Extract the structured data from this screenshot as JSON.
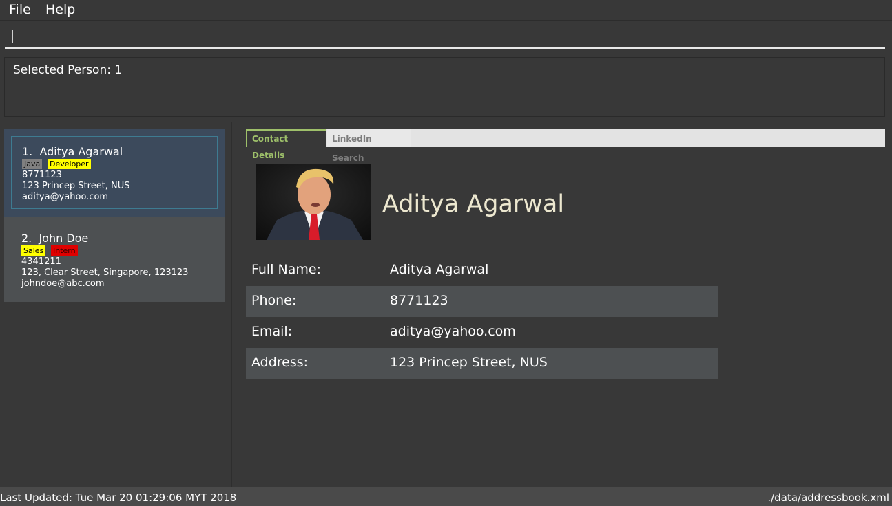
{
  "menu": {
    "file": "File",
    "help": "Help"
  },
  "command_box": {
    "value": ""
  },
  "result_display": {
    "text": "Selected Person: 1"
  },
  "person_list": [
    {
      "index": "1.",
      "name": "Aditya Agarwal",
      "tags": [
        {
          "label": "Java",
          "color": "#808080"
        },
        {
          "label": "Developer",
          "color": "#ffff00"
        }
      ],
      "phone": "8771123",
      "address": "123 Princep Street, NUS",
      "email": "aditya@yahoo.com"
    },
    {
      "index": "2.",
      "name": "John Doe",
      "tags": [
        {
          "label": "Sales",
          "color": "#ffff00"
        },
        {
          "label": "Intern",
          "color": "#e00000"
        }
      ],
      "phone": "4341211",
      "address": "123, Clear Street, Singapore, 123123",
      "email": "johndoe@abc.com"
    }
  ],
  "tabs": {
    "contact_details": "Contact Details",
    "linkedin_search": "LinkedIn Search"
  },
  "details": {
    "name": "Aditya Agarwal",
    "rows": [
      {
        "label": "Full Name:",
        "value": "Aditya Agarwal"
      },
      {
        "label": "Phone:",
        "value": "8771123"
      },
      {
        "label": "Email:",
        "value": "aditya@yahoo.com"
      },
      {
        "label": "Address:",
        "value": "123 Princep Street, NUS"
      }
    ]
  },
  "status": {
    "last_updated": "Last Updated: Tue Mar 20 01:29:06 MYT 2018",
    "file_path": "./data/addressbook.xml"
  },
  "colors": {
    "background": "#383838",
    "selected_card": "#3c4a5c",
    "card": "#4d5052",
    "active_tab": "#9ec06a",
    "detail_name": "#ece7cf"
  }
}
